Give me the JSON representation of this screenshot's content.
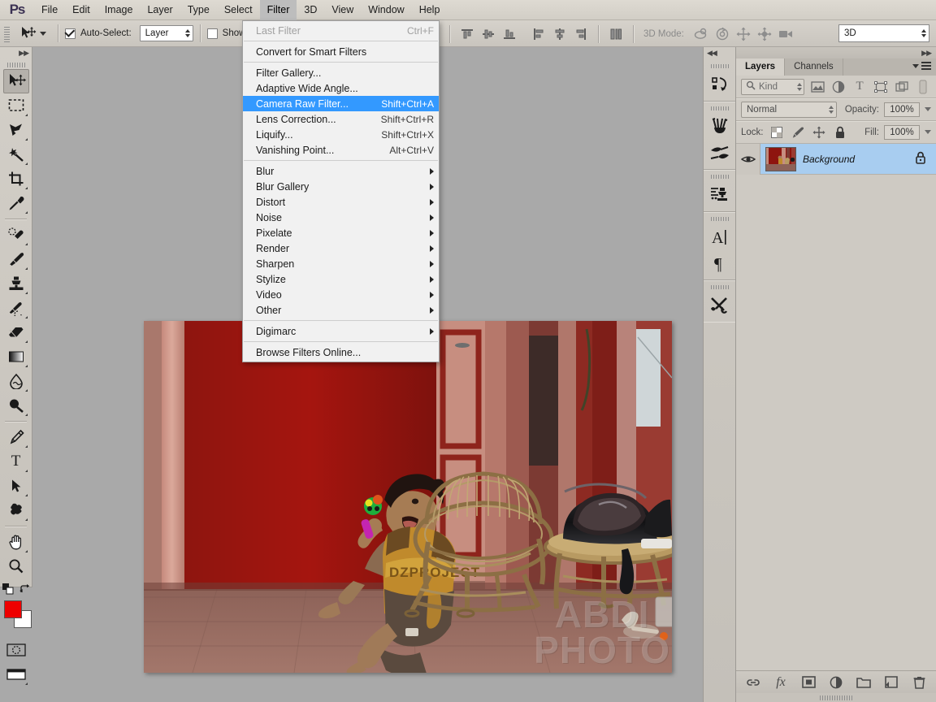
{
  "app": {
    "logo": "Ps"
  },
  "menubar": {
    "items": [
      {
        "label": "File",
        "active": false
      },
      {
        "label": "Edit",
        "active": false
      },
      {
        "label": "Image",
        "active": false
      },
      {
        "label": "Layer",
        "active": false
      },
      {
        "label": "Type",
        "active": false
      },
      {
        "label": "Select",
        "active": false
      },
      {
        "label": "Filter",
        "active": true
      },
      {
        "label": "3D",
        "active": false
      },
      {
        "label": "View",
        "active": false
      },
      {
        "label": "Window",
        "active": false
      },
      {
        "label": "Help",
        "active": false
      }
    ]
  },
  "options_bar": {
    "tool_icon": "move-tool-icon",
    "auto_select_label": "Auto-Select:",
    "auto_select_checked": true,
    "auto_select_scope": "Layer",
    "show_transform_label": "Show Tran",
    "show_transform_checked": false,
    "mode_3d_label": "3D Mode:",
    "workspace_value": "3D",
    "align_icons": [
      "align-top-edges-icon",
      "align-vertical-centers-icon",
      "align-bottom-edges-icon",
      "align-left-edges-icon",
      "align-horizontal-centers-icon",
      "align-right-edges-icon",
      "distribute-icon"
    ],
    "mode_3d_icons": [
      "rotate-3d-object-icon",
      "roll-3d-object-icon",
      "drag-3d-object-icon",
      "slide-3d-object-icon",
      "scale-3d-object-icon"
    ]
  },
  "filter_menu": {
    "items": [
      {
        "label": "Last Filter",
        "shortcut": "Ctrl+F",
        "disabled": true,
        "submenu": false,
        "highlighted": false
      },
      {
        "sep": true
      },
      {
        "label": "Convert for Smart Filters",
        "shortcut": "",
        "disabled": false,
        "submenu": false,
        "highlighted": false
      },
      {
        "sep": true
      },
      {
        "label": "Filter Gallery...",
        "shortcut": "",
        "disabled": false,
        "submenu": false,
        "highlighted": false
      },
      {
        "label": "Adaptive Wide Angle...",
        "shortcut": "",
        "disabled": false,
        "submenu": false,
        "highlighted": false
      },
      {
        "label": "Camera Raw Filter...",
        "shortcut": "Shift+Ctrl+A",
        "disabled": false,
        "submenu": false,
        "highlighted": true
      },
      {
        "label": "Lens Correction...",
        "shortcut": "Shift+Ctrl+R",
        "disabled": false,
        "submenu": false,
        "highlighted": false
      },
      {
        "label": "Liquify...",
        "shortcut": "Shift+Ctrl+X",
        "disabled": false,
        "submenu": false,
        "highlighted": false
      },
      {
        "label": "Vanishing Point...",
        "shortcut": "Alt+Ctrl+V",
        "disabled": false,
        "submenu": false,
        "highlighted": false
      },
      {
        "sep": true
      },
      {
        "label": "Blur",
        "shortcut": "",
        "disabled": false,
        "submenu": true,
        "highlighted": false
      },
      {
        "label": "Blur Gallery",
        "shortcut": "",
        "disabled": false,
        "submenu": true,
        "highlighted": false
      },
      {
        "label": "Distort",
        "shortcut": "",
        "disabled": false,
        "submenu": true,
        "highlighted": false
      },
      {
        "label": "Noise",
        "shortcut": "",
        "disabled": false,
        "submenu": true,
        "highlighted": false
      },
      {
        "label": "Pixelate",
        "shortcut": "",
        "disabled": false,
        "submenu": true,
        "highlighted": false
      },
      {
        "label": "Render",
        "shortcut": "",
        "disabled": false,
        "submenu": true,
        "highlighted": false
      },
      {
        "label": "Sharpen",
        "shortcut": "",
        "disabled": false,
        "submenu": true,
        "highlighted": false
      },
      {
        "label": "Stylize",
        "shortcut": "",
        "disabled": false,
        "submenu": true,
        "highlighted": false
      },
      {
        "label": "Video",
        "shortcut": "",
        "disabled": false,
        "submenu": true,
        "highlighted": false
      },
      {
        "label": "Other",
        "shortcut": "",
        "disabled": false,
        "submenu": true,
        "highlighted": false
      },
      {
        "sep": true
      },
      {
        "label": "Digimarc",
        "shortcut": "",
        "disabled": false,
        "submenu": true,
        "highlighted": false
      },
      {
        "sep": true
      },
      {
        "label": "Browse Filters Online...",
        "shortcut": "",
        "disabled": false,
        "submenu": false,
        "highlighted": false
      }
    ],
    "highlight_color": "#3399ff"
  },
  "toolbar": {
    "collapse_icon": "double-chevron-right-icon",
    "tools": [
      {
        "icon": "move-tool-icon",
        "selected": true,
        "has_flyout": false
      },
      {
        "icon": "rectangular-marquee-tool-icon",
        "selected": false,
        "has_flyout": true
      },
      {
        "icon": "lasso-tool-icon",
        "selected": false,
        "has_flyout": true
      },
      {
        "icon": "quick-selection-magic-wand-tool-icon",
        "selected": false,
        "has_flyout": true
      },
      {
        "icon": "crop-tool-icon",
        "selected": false,
        "has_flyout": true
      },
      {
        "icon": "eyedropper-tool-icon",
        "selected": false,
        "has_flyout": true
      },
      {
        "sep": true
      },
      {
        "icon": "spot-healing-brush-tool-icon",
        "selected": false,
        "has_flyout": true
      },
      {
        "icon": "brush-tool-icon",
        "selected": false,
        "has_flyout": true
      },
      {
        "icon": "clone-stamp-tool-icon",
        "selected": false,
        "has_flyout": true
      },
      {
        "icon": "history-brush-tool-icon",
        "selected": false,
        "has_flyout": true
      },
      {
        "icon": "eraser-tool-icon",
        "selected": false,
        "has_flyout": true
      },
      {
        "icon": "gradient-tool-icon",
        "selected": false,
        "has_flyout": true
      },
      {
        "icon": "blur-smudge-tool-icon",
        "selected": false,
        "has_flyout": true
      },
      {
        "icon": "dodge-burn-tool-icon",
        "selected": false,
        "has_flyout": true
      },
      {
        "sep": true
      },
      {
        "icon": "pen-tool-icon",
        "selected": false,
        "has_flyout": true
      },
      {
        "icon": "type-tool-icon",
        "selected": false,
        "has_flyout": true
      },
      {
        "icon": "path-selection-tool-icon",
        "selected": false,
        "has_flyout": true
      },
      {
        "icon": "custom-shape-tool-icon",
        "selected": false,
        "has_flyout": true
      },
      {
        "sep": true
      },
      {
        "icon": "hand-tool-icon",
        "selected": false,
        "has_flyout": true
      },
      {
        "icon": "zoom-tool-icon",
        "selected": false,
        "has_flyout": false
      }
    ],
    "foreground_color": "#ee0000",
    "background_color": "#ffffff",
    "swap_colors_icon": "swap-colors-icon",
    "default_colors_icon": "default-colors-icon",
    "quick_mask_icon": "quick-mask-mode-icon",
    "screen_mode_icon": "screen-mode-icon"
  },
  "icon_dock": {
    "collapse_icon": "double-chevron-left-icon",
    "groups": [
      {
        "icons": [
          "history-icon"
        ]
      },
      {
        "icons": [
          "brush-presets-icon",
          "brush-settings-icon"
        ]
      },
      {
        "icons": [
          "adjustments-icon"
        ]
      },
      {
        "icons": [
          "character-panel-icon",
          "paragraph-panel-icon"
        ]
      },
      {
        "icons": [
          "tool-presets-icon"
        ]
      }
    ]
  },
  "layers_panel": {
    "collapse_icon": "double-chevron-right-icon",
    "tabs": [
      {
        "label": "Layers",
        "active": true
      },
      {
        "label": "Channels",
        "active": false
      }
    ],
    "menu_icon": "panel-menu-icon",
    "filter": {
      "kind_label": "Kind",
      "search_icon": "search-icon",
      "type_icons": [
        "filter-pixel-icon",
        "filter-adjustment-icon",
        "filter-type-icon",
        "filter-shape-icon",
        "filter-smart-object-icon"
      ],
      "toggle_icon": "filter-toggle-icon"
    },
    "blend_mode": "Normal",
    "opacity_label": "Opacity:",
    "opacity_value": "100%",
    "lock_label": "Lock:",
    "lock_icons": [
      "lock-transparent-pixels-icon",
      "lock-image-pixels-icon",
      "lock-position-icon",
      "lock-all-icon"
    ],
    "fill_label": "Fill:",
    "fill_value": "100%",
    "layers": [
      {
        "name": "Background",
        "visible": true,
        "locked": true,
        "selected": true,
        "visibility_icon": "eye-icon",
        "lock_icon": "lock-icon",
        "thumbnail": "photo-thumbnail"
      }
    ],
    "bottom_icons": [
      "link-layers-icon",
      "layer-style-fx-icon",
      "add-layer-mask-icon",
      "new-adjustment-layer-icon",
      "new-group-icon",
      "new-layer-icon",
      "delete-layer-icon"
    ],
    "selection_color": "#a8cdf0"
  },
  "canvas": {
    "background_color": "#a9a9a9",
    "image": {
      "alt": "Young boy kneeling on tiled porch shouting, holding a green toy, in front of a red wall; rattan chair and table with motorcycle helmet to the right",
      "watermark_line1": "ABDI",
      "watermark_line2": "PHOTO"
    }
  }
}
